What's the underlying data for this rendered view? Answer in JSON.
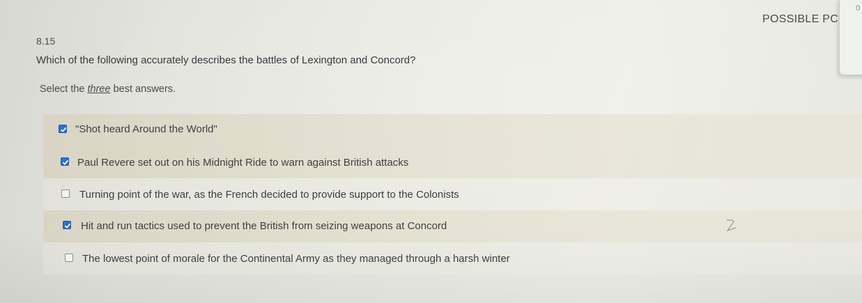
{
  "header": {
    "points_label": "POSSIBLE PC",
    "corner_mark": "0"
  },
  "question": {
    "number": "8.15",
    "text": "Which of the following accurately describes the battles of Lexington and Concord?",
    "instructions_before": "Select the ",
    "instructions_emphasis": "three",
    "instructions_after": " best answers."
  },
  "options": [
    {
      "label": "\"Shot heard Around the World\"",
      "checked": true
    },
    {
      "label": "Paul Revere set out on his Midnight Ride to warn against British attacks",
      "checked": true
    },
    {
      "label": "Turning point of the war, as the French decided to provide support to the Colonists",
      "checked": false
    },
    {
      "label": "Hit and run tactics used to prevent the British from seizing weapons at Concord",
      "checked": true
    },
    {
      "label": "The lowest point of morale for the Continental Army as they managed through a harsh winter",
      "checked": false
    }
  ],
  "icons": {
    "checked": "checkbox-checked-icon",
    "unchecked": "checkbox-empty-icon"
  },
  "colors": {
    "checkbox_accent": "#2f6fd1",
    "selected_row_shade": "#dcd3bb"
  }
}
